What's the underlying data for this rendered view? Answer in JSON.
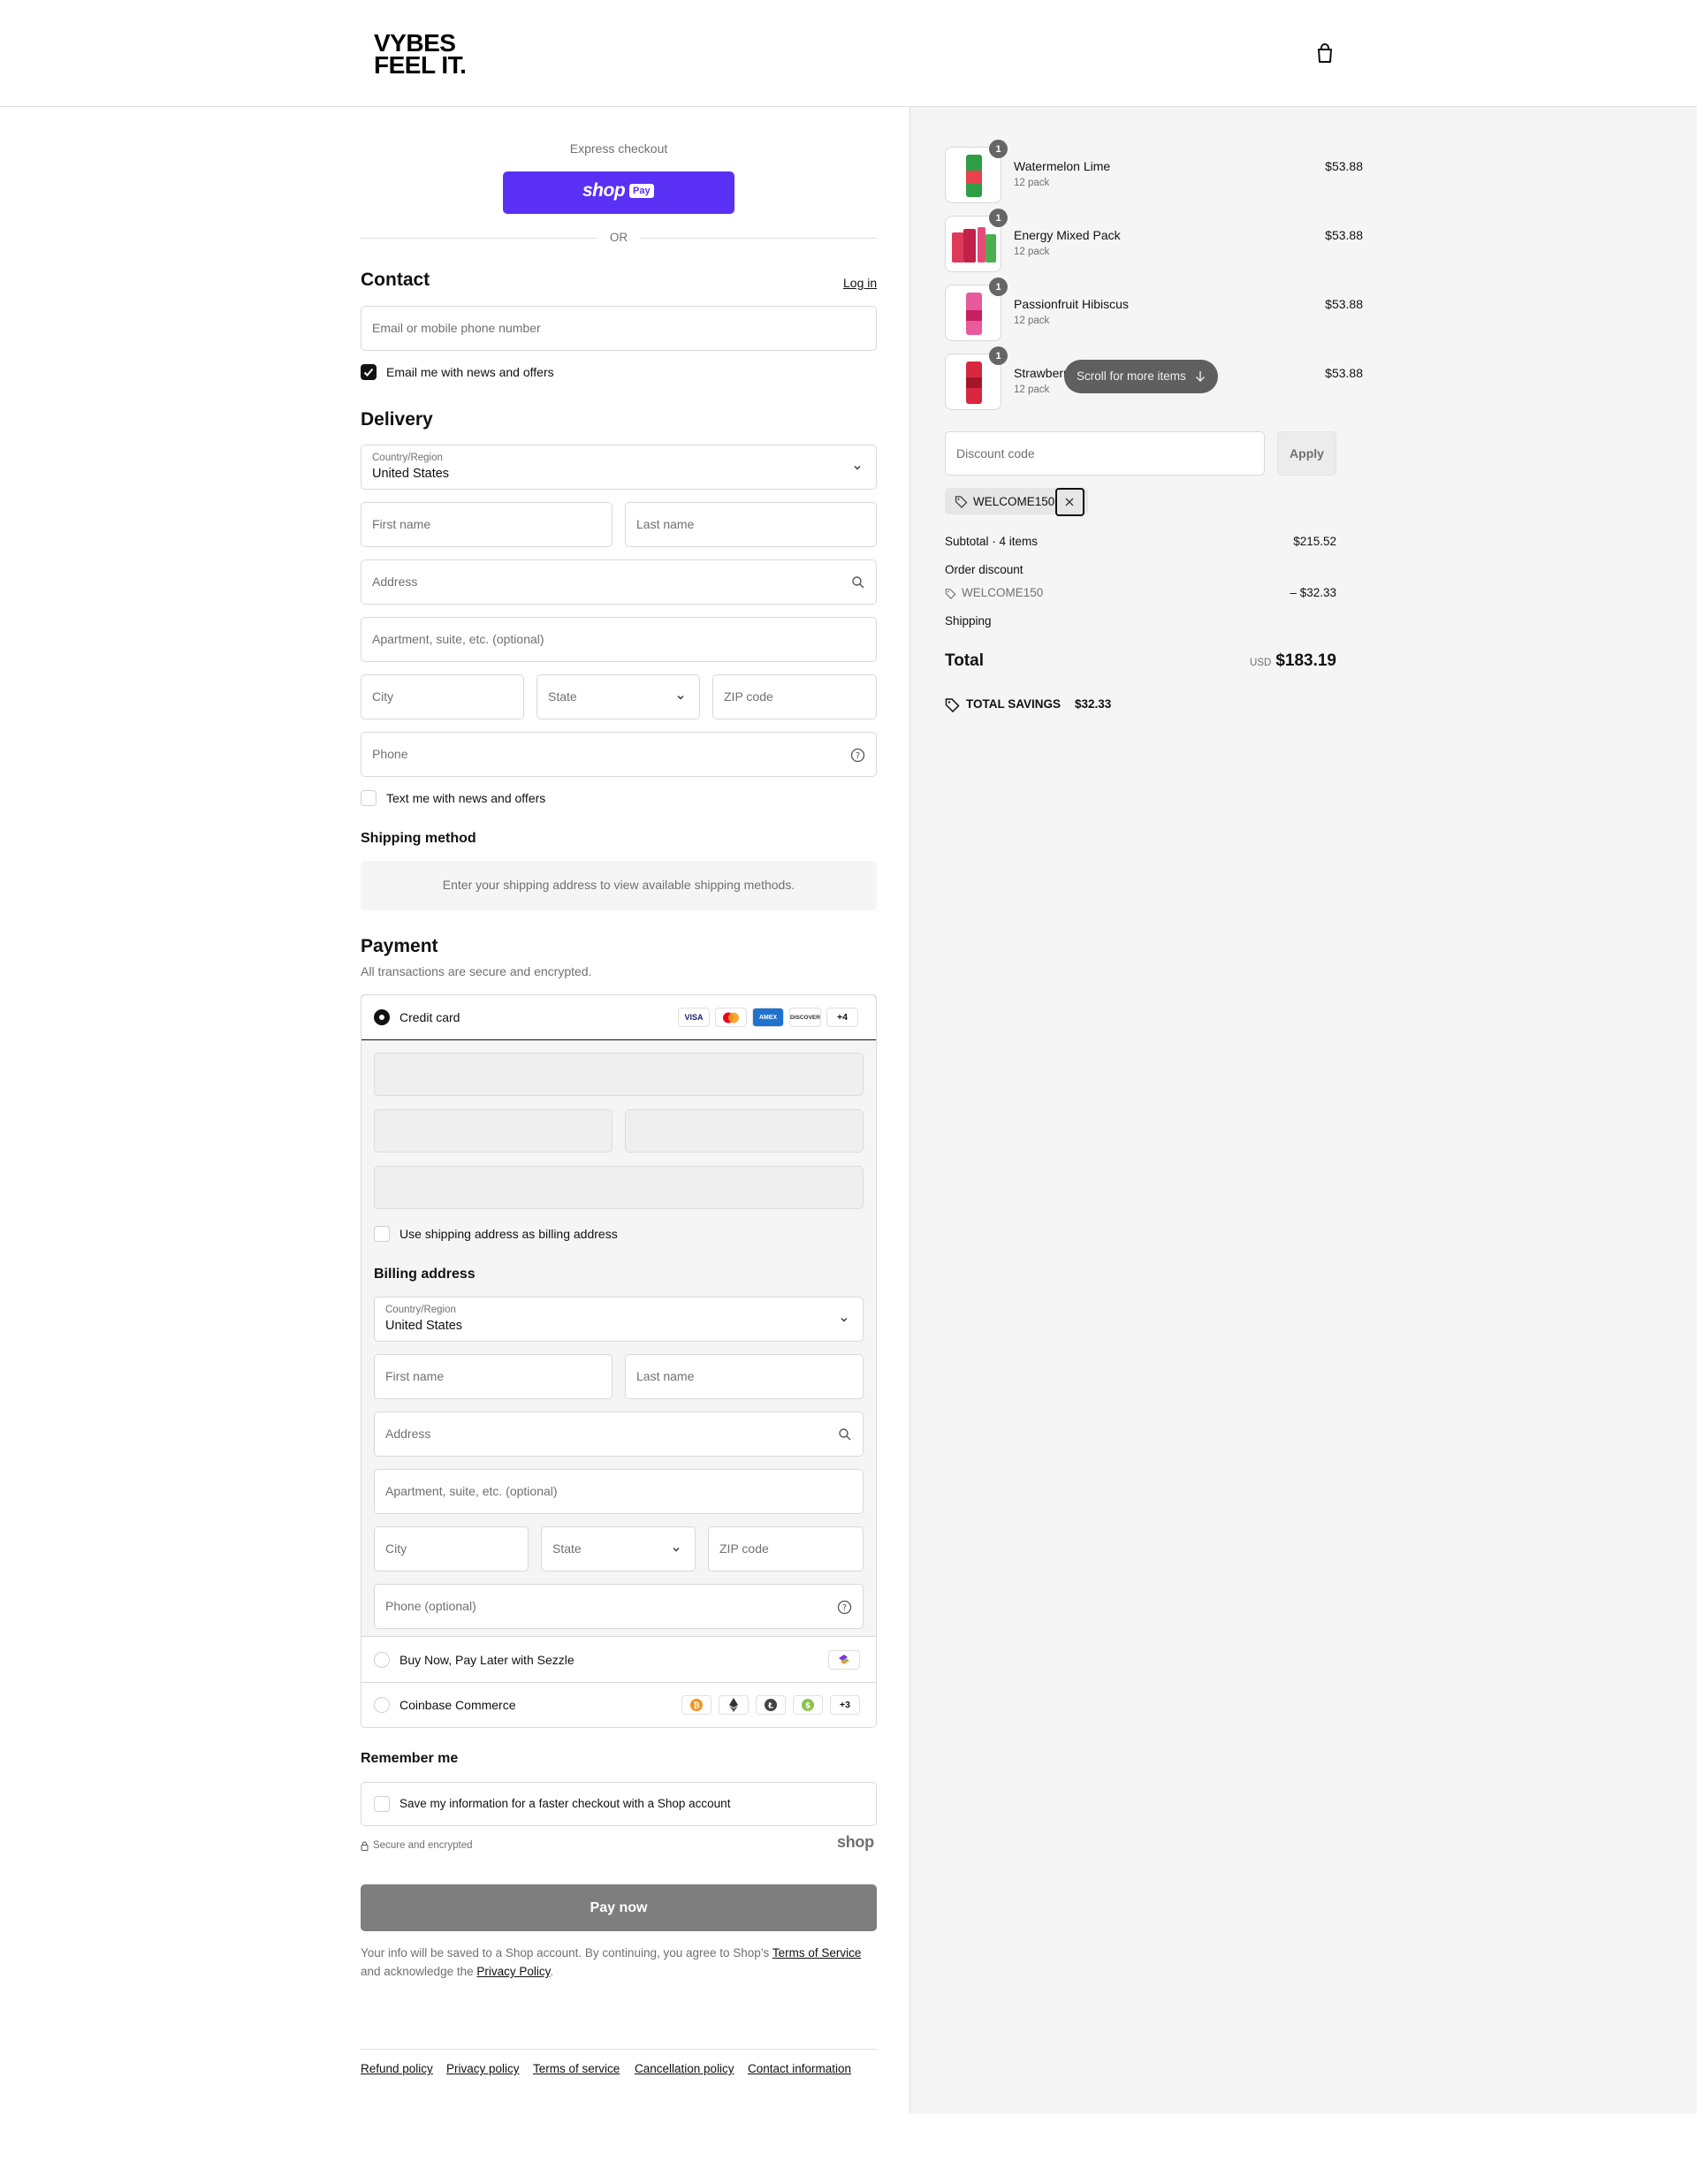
{
  "brand": {
    "line1": "VYBES",
    "line2": "FEEL IT."
  },
  "express": {
    "label": "Express checkout",
    "shop_word": "shop",
    "pay_word": "Pay",
    "or": "OR",
    "color": "#5a31f4"
  },
  "contact": {
    "title": "Contact",
    "login": "Log in",
    "email_placeholder": "Email or mobile phone number",
    "news_label": "Email me with news and offers",
    "news_checked": true
  },
  "delivery": {
    "title": "Delivery",
    "country_label": "Country/Region",
    "country_value": "United States",
    "first_name": "First name",
    "last_name": "Last name",
    "address": "Address",
    "apartment": "Apartment, suite, etc. (optional)",
    "city": "City",
    "state": "State",
    "zip": "ZIP code",
    "phone": "Phone",
    "text_label": "Text me with news and offers"
  },
  "shipping": {
    "title": "Shipping method",
    "notice": "Enter your shipping address to view available shipping methods."
  },
  "payment": {
    "title": "Payment",
    "subtitle": "All transactions are secure and encrypted.",
    "credit_card": "Credit card",
    "card_brands": [
      "VISA",
      "MC",
      "AMEX",
      "DISCOVER"
    ],
    "more_cards": "+4",
    "billing_same": "Use shipping address as billing address",
    "billing_title": "Billing address",
    "billing": {
      "country_label": "Country/Region",
      "country_value": "United States",
      "first_name": "First name",
      "last_name": "Last name",
      "address": "Address",
      "apartment": "Apartment, suite, etc. (optional)",
      "city": "City",
      "state": "State",
      "zip": "ZIP code",
      "phone": "Phone (optional)"
    },
    "sezzle": "Buy Now, Pay Later with Sezzle",
    "coinbase": "Coinbase Commerce",
    "coin_more": "+3"
  },
  "remember": {
    "title": "Remember me",
    "save_label": "Save my information for a faster checkout with a Shop account",
    "secure": "Secure and encrypted",
    "shop_logo": "shop"
  },
  "pay_now": "Pay now",
  "legal": {
    "text1": "Your info will be saved to a Shop account. By continuing, you agree to Shop’s",
    "tos": "Terms of Service",
    "text2": "and acknowledge the",
    "privacy": "Privacy Policy",
    "end": "."
  },
  "footer": [
    "Refund policy",
    "Privacy policy",
    "Terms of service",
    "Cancellation policy",
    "Contact information"
  ],
  "order": {
    "items": [
      {
        "name": "Watermelon Lime",
        "variant": "12 pack",
        "price": "$53.88",
        "qty": "1"
      },
      {
        "name": "Energy Mixed Pack",
        "variant": "12 pack",
        "price": "$53.88",
        "qty": "1"
      },
      {
        "name": "Passionfruit Hibiscus",
        "variant": "12 pack",
        "price": "$53.88",
        "qty": "1"
      },
      {
        "name": "Strawberr",
        "variant": "12 pack",
        "price": "$53.88",
        "qty": "1"
      }
    ],
    "scroll_hint": "Scroll for more items",
    "discount_placeholder": "Discount code",
    "apply": "Apply",
    "applied_code": "WELCOME150",
    "subtotal_label": "Subtotal · 4 items",
    "subtotal": "$215.52",
    "order_discount": "Order discount",
    "discount_code": "WELCOME150",
    "discount_amount": "– $32.33",
    "shipping_label": "Shipping",
    "total_label": "Total",
    "currency": "USD",
    "total": "$183.19",
    "savings_label": "TOTAL SAVINGS",
    "savings": "$32.33"
  }
}
